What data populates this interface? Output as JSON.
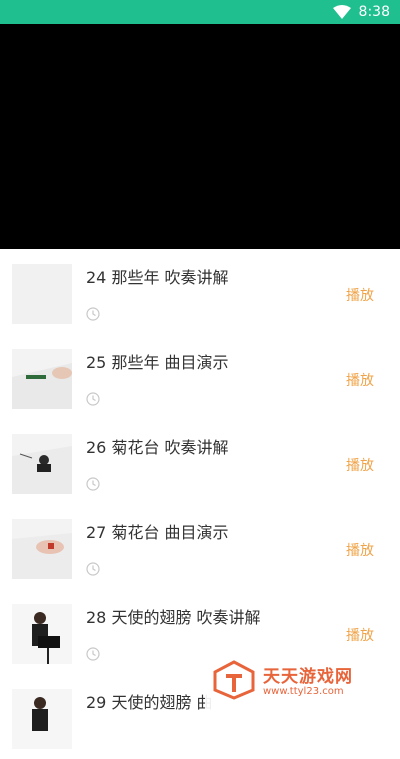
{
  "status_bar": {
    "time": "8:38",
    "icons": [
      "wifi-icon"
    ],
    "color": "#1fbf8f"
  },
  "video": {
    "state": "black-screen"
  },
  "episodes": [
    {
      "title": "24 那些年 吹奏讲解",
      "action": "播放"
    },
    {
      "title": "25 那些年 曲目演示",
      "action": "播放"
    },
    {
      "title": "26 菊花台 吹奏讲解",
      "action": "播放"
    },
    {
      "title": "27 菊花台 曲目演示",
      "action": "播放"
    },
    {
      "title": "28 天使的翅膀 吹奏讲解",
      "action": "播放"
    },
    {
      "title": "29 天使的翅膀 曲",
      "action": ""
    }
  ],
  "colors": {
    "accent": "#f0a44a",
    "title": "#333333"
  },
  "watermark": {
    "brand": "天天游戏网",
    "url": "www.ttyl23.com"
  }
}
